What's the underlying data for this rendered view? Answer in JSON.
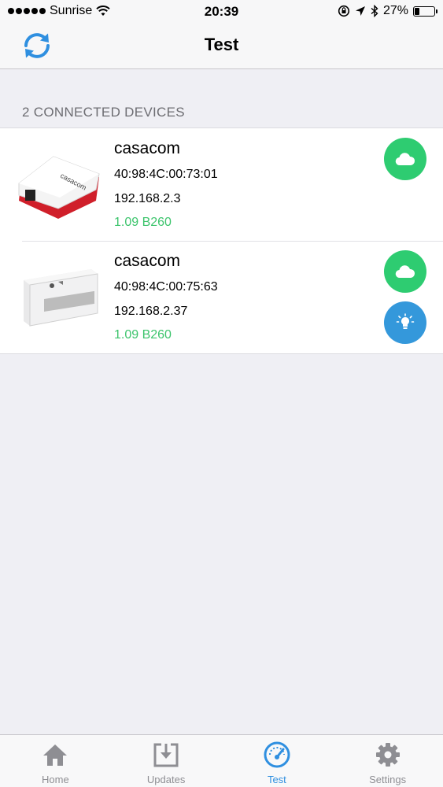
{
  "status_bar": {
    "carrier": "Sunrise",
    "time": "20:39",
    "battery_text": "27%",
    "battery_level": 0.27
  },
  "nav": {
    "title": "Test"
  },
  "section": {
    "header": "2 CONNECTED DEVICES"
  },
  "devices": [
    {
      "name": "casacom",
      "mac": "40:98:4C:00:73:01",
      "ip": "192.168.2.3",
      "version": "1.09 B260",
      "icons": [
        "cloud-icon"
      ]
    },
    {
      "name": "casacom",
      "mac": "40:98:4C:00:75:63",
      "ip": "192.168.2.37",
      "version": "1.09 B260",
      "icons": [
        "cloud-icon",
        "lightbulb-icon"
      ]
    }
  ],
  "tabs": [
    {
      "label": "Home",
      "icon": "home-icon",
      "active": false
    },
    {
      "label": "Updates",
      "icon": "download-icon",
      "active": false
    },
    {
      "label": "Test",
      "icon": "speedometer-icon",
      "active": true
    },
    {
      "label": "Settings",
      "icon": "gear-icon",
      "active": false
    }
  ],
  "colors": {
    "accent": "#2f8fe0",
    "green": "#2ecc71",
    "blue": "#3498db",
    "version_green": "#3cc46c",
    "tab_inactive": "#8e8e93"
  }
}
